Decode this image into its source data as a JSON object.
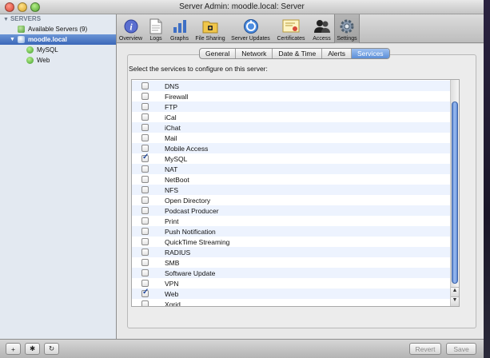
{
  "window": {
    "title": "Server Admin: moodle.local: Server"
  },
  "sidebar": {
    "header": "SERVERS",
    "all_servers": "Available Servers (9)",
    "selected_server": "moodle.local",
    "services": [
      "MySQL",
      "Web"
    ]
  },
  "toolbar": {
    "items": [
      {
        "label": "Overview",
        "icon": "info-icon"
      },
      {
        "label": "Logs",
        "icon": "document-icon"
      },
      {
        "label": "Graphs",
        "icon": "bar-chart-icon"
      },
      {
        "label": "File Sharing",
        "icon": "file-sharing-icon"
      },
      {
        "label": "Server Updates",
        "icon": "software-update-icon"
      },
      {
        "label": "Certificates",
        "icon": "certificate-icon"
      },
      {
        "label": "Access",
        "icon": "users-icon"
      },
      {
        "label": "Settings",
        "icon": "gear-icon"
      }
    ],
    "active": "Settings"
  },
  "tabs": {
    "items": [
      "General",
      "Network",
      "Date & Time",
      "Alerts",
      "Services"
    ],
    "active": "Services"
  },
  "services_panel": {
    "instructions": "Select the services to configure on this server:",
    "services": [
      {
        "name": "DNS",
        "checked": false
      },
      {
        "name": "Firewall",
        "checked": false
      },
      {
        "name": "FTP",
        "checked": false
      },
      {
        "name": "iCal",
        "checked": false
      },
      {
        "name": "iChat",
        "checked": false
      },
      {
        "name": "Mail",
        "checked": false
      },
      {
        "name": "Mobile Access",
        "checked": false
      },
      {
        "name": "MySQL",
        "checked": true
      },
      {
        "name": "NAT",
        "checked": false
      },
      {
        "name": "NetBoot",
        "checked": false
      },
      {
        "name": "NFS",
        "checked": false
      },
      {
        "name": "Open Directory",
        "checked": false
      },
      {
        "name": "Podcast Producer",
        "checked": false
      },
      {
        "name": "Print",
        "checked": false
      },
      {
        "name": "Push Notification",
        "checked": false
      },
      {
        "name": "QuickTime Streaming",
        "checked": false
      },
      {
        "name": "RADIUS",
        "checked": false
      },
      {
        "name": "SMB",
        "checked": false
      },
      {
        "name": "Software Update",
        "checked": false
      },
      {
        "name": "VPN",
        "checked": false
      },
      {
        "name": "Web",
        "checked": true
      },
      {
        "name": "Xgrid",
        "checked": false
      }
    ]
  },
  "bottom_bar": {
    "add_label": "+",
    "gear_label": "✱",
    "refresh_label": "↻",
    "revert_label": "Revert",
    "save_label": "Save"
  },
  "colors": {
    "selection_blue": "#3b67b8",
    "tab_active": "#5c8fd8",
    "row_alt": "#edf3fe"
  }
}
